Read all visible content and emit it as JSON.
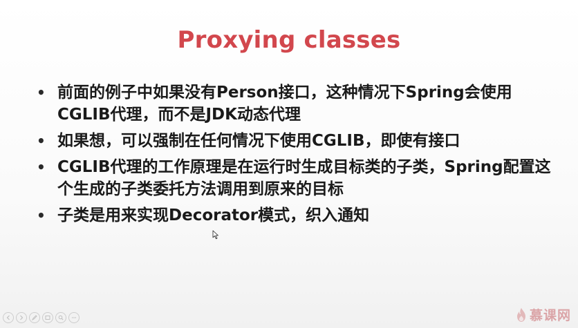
{
  "slide": {
    "title": "Proxying classes",
    "bullets": [
      "前面的例子中如果没有Person接口，这种情况下Spring会使用CGLIB代理，而不是JDK动态代理",
      "如果想，可以强制在任何情况下使用CGLIB，即使有接口",
      "CGLIB代理的工作原理是在运行时生成目标类的子类，Spring配置这个生成的子类委托方法调用到原来的目标",
      "子类是用来实现Decorator模式，织入通知"
    ],
    "bullet_symbol": "•"
  },
  "nav_controls": {
    "icons": [
      "prev-icon",
      "next-icon",
      "pen-icon",
      "slides-icon",
      "zoom-icon",
      "more-icon"
    ]
  },
  "watermark": {
    "text": "慕课网",
    "icon": "flame-icon"
  },
  "colors": {
    "title": "#d2474d",
    "text": "#1a1a1a",
    "watermark": "#c9686c"
  }
}
